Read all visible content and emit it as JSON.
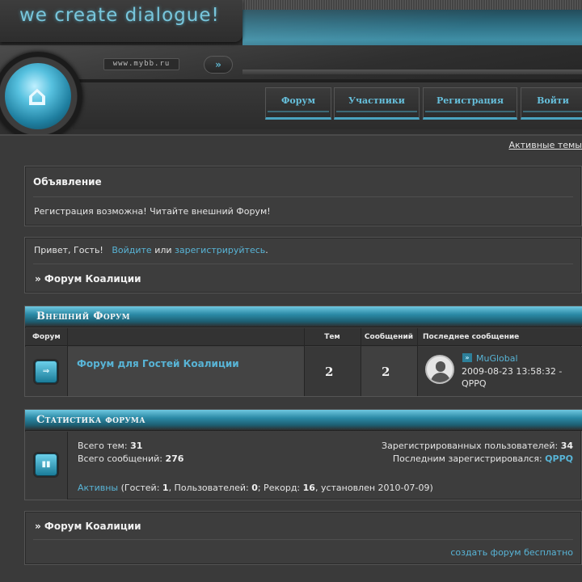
{
  "header": {
    "logo_text": "we create dialogue!",
    "url": "www.mybb.ru",
    "url_go": "»"
  },
  "nav": [
    {
      "label": "Форум"
    },
    {
      "label": "Участники"
    },
    {
      "label": "Регистрация"
    },
    {
      "label": "Войти"
    }
  ],
  "active_topics": "Активные темы",
  "announcement": {
    "title": "Объявление",
    "text": "Регистрация возможна! Читайте внешний Форум!"
  },
  "greeting": {
    "prefix": "Привет, Гость!",
    "login": "Войдите",
    "or": "или",
    "register": "зарегистрируйтесь",
    "dot": ".",
    "forum_title": "» Форум Коалиции"
  },
  "category": {
    "title": "Внешний Форум",
    "columns": {
      "forum": "Форум",
      "topics": "Тем",
      "posts": "Сообщений",
      "last": "Последнее сообщение"
    },
    "forum": {
      "name": "Форум для Гостей Коалиции",
      "topics": "2",
      "posts": "2",
      "last_user": "MuGlobal",
      "last_date": "2009-08-23 13:58:32 -",
      "last_author": "QPPQ"
    }
  },
  "stats": {
    "title": "Статистика форума",
    "topics_label": "Всего тем:",
    "topics_value": "31",
    "posts_label": "Всего сообщений:",
    "posts_value": "276",
    "users_label": "Зарегистрированных пользователей:",
    "users_value": "34",
    "last_reg_label": "Последним зарегистрировался:",
    "last_reg_value": "QPPQ",
    "online_link": "Активны",
    "online_a": "(Гостей:",
    "online_guests": "1",
    "online_b": ", Пользователей:",
    "online_users": "0",
    "online_c": "; Рекорд:",
    "online_record": "16",
    "online_d": ", установлен 2010-07-09)"
  },
  "footer": {
    "forum_title": "» Форум Коалиции",
    "create_link": "создать форум бесплатно"
  }
}
